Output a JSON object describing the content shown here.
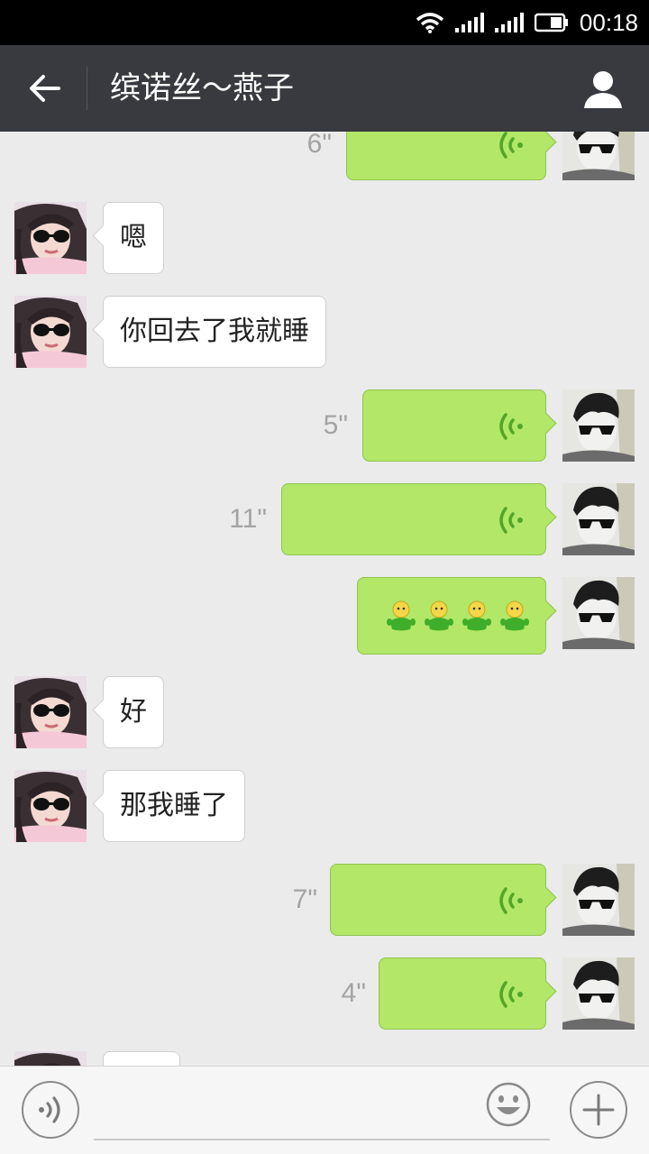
{
  "status_bar": {
    "time": "00:18"
  },
  "header": {
    "title": "缤诺丝～燕子",
    "back_icon": "arrow-left-icon",
    "profile_icon": "person-icon"
  },
  "messages": [
    {
      "from": "me",
      "type": "voice",
      "duration": "6\""
    },
    {
      "from": "them",
      "type": "text",
      "text": "嗯"
    },
    {
      "from": "them",
      "type": "text",
      "text": "你回去了我就睡"
    },
    {
      "from": "me",
      "type": "voice",
      "duration": "5\""
    },
    {
      "from": "me",
      "type": "voice",
      "duration": "11\""
    },
    {
      "from": "me",
      "type": "emoji",
      "count": 4,
      "emoji_icon": "green-figure-emoji"
    },
    {
      "from": "them",
      "type": "text",
      "text": "好"
    },
    {
      "from": "them",
      "type": "text",
      "text": "那我睡了"
    },
    {
      "from": "me",
      "type": "voice",
      "duration": "7\""
    },
    {
      "from": "me",
      "type": "voice",
      "duration": "4\""
    },
    {
      "from": "them",
      "type": "text",
      "text": ""
    }
  ],
  "input_bar": {
    "placeholder": "",
    "voice_icon": "voice-icon",
    "emoji_icon": "smiley-icon",
    "add_icon": "plus-icon"
  },
  "colors": {
    "outgoing_bubble": "#b2e767",
    "incoming_bubble": "#ffffff",
    "header_bg": "#393a3f",
    "chat_bg": "#ebebeb"
  }
}
